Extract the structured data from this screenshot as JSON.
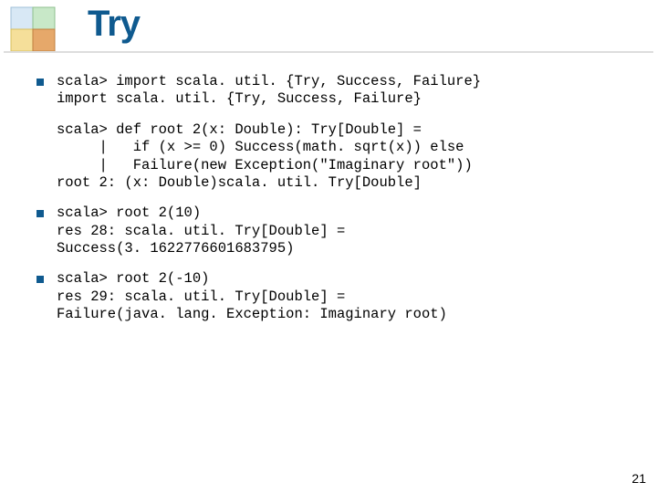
{
  "title": "Try",
  "page": "21",
  "blocks": {
    "0": "scala> import scala. util. {Try, Success, Failure}\nimport scala. util. {Try, Success, Failure}",
    "1": "scala> def root 2(x: Double): Try[Double] =\n     |   if (x >= 0) Success(math. sqrt(x)) else\n     |   Failure(new Exception(\"Imaginary root\"))\nroot 2: (x: Double)scala. util. Try[Double]",
    "2": "scala> root 2(10)\nres 28: scala. util. Try[Double] =\nSuccess(3. 1622776601683795)",
    "3": "scala> root 2(-10)\nres 29: scala. util. Try[Double] =\nFailure(java. lang. Exception: Imaginary root)"
  }
}
